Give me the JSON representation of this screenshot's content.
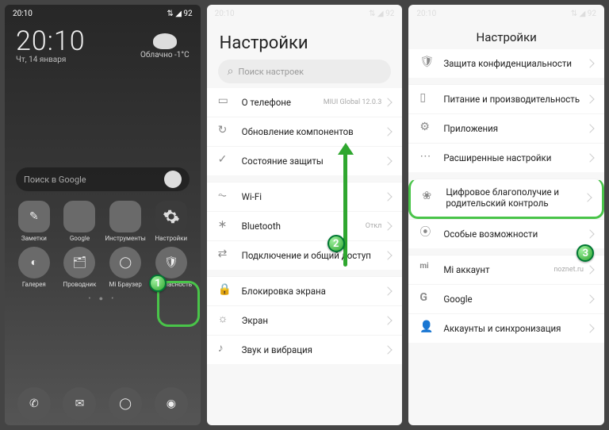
{
  "statusbar": {
    "time": "20:10",
    "battery": "92"
  },
  "panel1": {
    "clock": "20:10",
    "date": "Чт, 14 января",
    "weather": {
      "label": "Облачно",
      "temp": "-1°C"
    },
    "search_placeholder": "Поиск в Google",
    "apps_row1": [
      {
        "label": "Заметки"
      },
      {
        "label": "Google"
      },
      {
        "label": "Инструменты"
      },
      {
        "label": "Настройки"
      }
    ],
    "apps_row2": [
      {
        "label": "Галерея"
      },
      {
        "label": "Проводник"
      },
      {
        "label": "Mi Браузер"
      },
      {
        "label": "Безопасность"
      }
    ],
    "step": "1"
  },
  "panel2": {
    "title": "Настройки",
    "search_placeholder": "Поиск настроек",
    "items": [
      {
        "label": "О телефоне",
        "value": "MIUI Global 12.0.3"
      },
      {
        "label": "Обновление компонентов"
      },
      {
        "label": "Состояние защиты"
      },
      {
        "label": "Wi-Fi"
      },
      {
        "label": "Bluetooth",
        "value": "Откл"
      },
      {
        "label": "Подключение и общий доступ"
      },
      {
        "label": "Блокировка экрана"
      },
      {
        "label": "Экран"
      },
      {
        "label": "Звук и вибрация"
      }
    ],
    "step": "2"
  },
  "panel3": {
    "title": "Настройки",
    "items": [
      {
        "label": "Защита конфиденциальности"
      },
      {
        "label": "Питание и производительность"
      },
      {
        "label": "Приложения"
      },
      {
        "label": "Расширенные настройки"
      },
      {
        "label": "Цифровое благополучие и родительский контроль",
        "highlight": true
      },
      {
        "label": "Особые возможности"
      },
      {
        "label": "Mi аккаунт",
        "value": "noznet.ru"
      },
      {
        "label": "Google"
      },
      {
        "label": "Аккаунты и синхронизация"
      }
    ],
    "step": "3"
  }
}
